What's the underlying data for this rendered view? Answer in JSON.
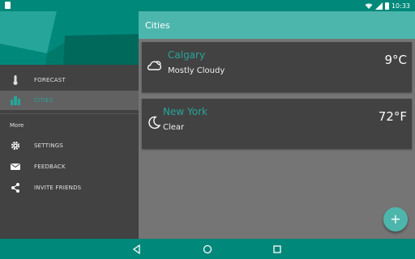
{
  "status_bar": {
    "time": "10:33",
    "icons": [
      "sim-card-icon",
      "wifi-icon",
      "signal-icon",
      "battery-icon"
    ]
  },
  "drawer": {
    "items": [
      {
        "label": "FORECAST",
        "icon": "thermometer-icon",
        "active": false
      },
      {
        "label": "CITIES",
        "icon": "city-buildings-icon",
        "active": true
      }
    ],
    "section_label": "More",
    "more_items": [
      {
        "label": "SETTINGS",
        "icon": "gear-icon"
      },
      {
        "label": "FEEDBACK",
        "icon": "mail-icon"
      },
      {
        "label": "INVITE FRIENDS",
        "icon": "share-icon"
      }
    ]
  },
  "appbar": {
    "title": "Cities"
  },
  "cities": [
    {
      "name": "Calgary",
      "condition": "Mostly Cloudy",
      "temperature": "9°C",
      "icon": "cloudy-night-icon"
    },
    {
      "name": "New York",
      "condition": "Clear",
      "temperature": "72°F",
      "icon": "moon-icon"
    }
  ],
  "fab": {
    "label": "+",
    "icon": "add-icon"
  },
  "colors": {
    "primary_dark": "#00887a",
    "primary": "#4db6ac",
    "accent": "#26a69a",
    "drawer_bg": "#424242",
    "content_bg": "#757575"
  },
  "nav_bar": {
    "icons": [
      "back-icon",
      "home-icon",
      "recents-icon"
    ]
  }
}
